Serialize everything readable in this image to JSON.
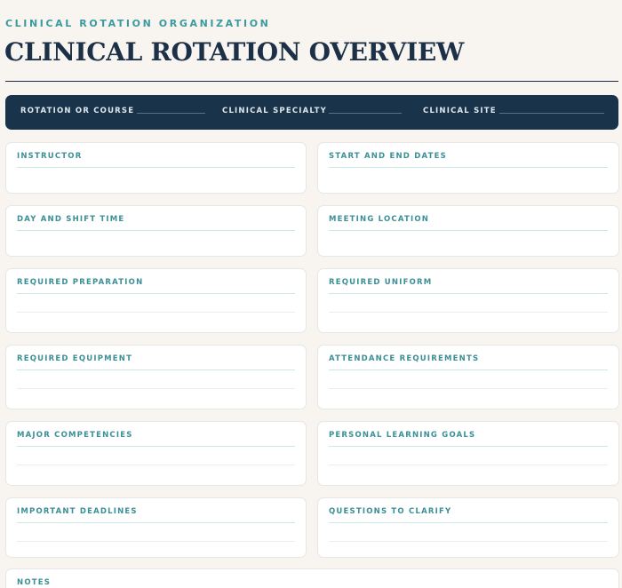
{
  "header": {
    "eyebrow": "CLINICAL ROTATION ORGANIZATION",
    "title": "CLINICAL ROTATION OVERVIEW"
  },
  "info_bar": {
    "rotation_label": "ROTATION OR COURSE",
    "specialty_label": "CLINICAL SPECIALTY",
    "site_label": "CLINICAL SITE"
  },
  "fields": {
    "instructor": "INSTRUCTOR",
    "dates": "START AND END DATES",
    "shift": "DAY AND SHIFT TIME",
    "meeting": "MEETING LOCATION",
    "preparation": "REQUIRED PREPARATION",
    "uniform": "REQUIRED UNIFORM",
    "equipment": "REQUIRED EQUIPMENT",
    "attendance": "ATTENDANCE REQUIREMENTS",
    "competencies": "MAJOR COMPETENCIES",
    "goals": "PERSONAL LEARNING GOALS",
    "deadlines": "IMPORTANT DEADLINES",
    "questions": "QUESTIONS TO CLARIFY",
    "notes": "NOTES"
  },
  "colors": {
    "accent": "#3a9aa0",
    "navy": "#19334a",
    "background": "#f8f5f0"
  }
}
